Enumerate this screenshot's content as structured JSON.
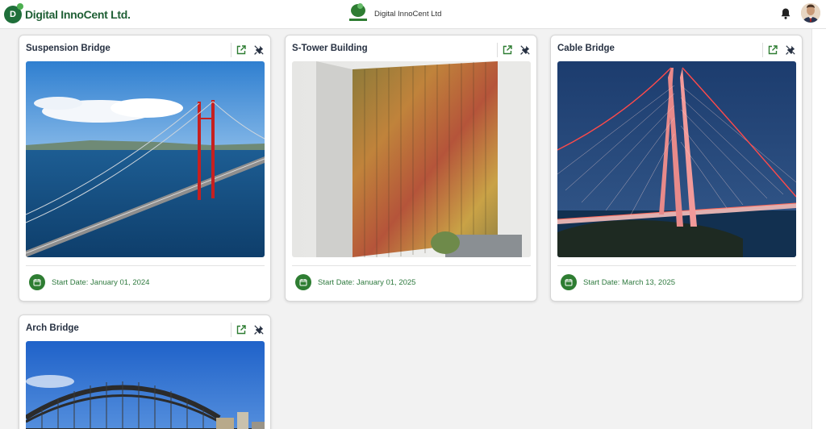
{
  "header": {
    "brand_text": "Digital InnoCent Ltd.",
    "brand_mark": "D",
    "center_title": "Digital InnoCent Ltd",
    "bell_icon": "bell-icon",
    "avatar": "user-avatar"
  },
  "colors": {
    "brand_green": "#2e7d32",
    "title_navy": "#273142",
    "date_green": "#2f7a3f"
  },
  "projects": [
    {
      "title": "Suspension Bridge",
      "start_label": "Start Date: January 01, 2024",
      "image": "suspension-bridge-photo"
    },
    {
      "title": "S-Tower Building",
      "start_label": "Start Date: January 01, 2025",
      "image": "tower-building-photo"
    },
    {
      "title": "Cable Bridge",
      "start_label": "Start Date: March 13, 2025",
      "image": "cable-bridge-photo"
    },
    {
      "title": "Arch Bridge",
      "start_label": "",
      "image": "arch-bridge-photo"
    }
  ],
  "card_icons": [
    "open-external-icon",
    "pin-icon",
    "calendar-icon"
  ]
}
